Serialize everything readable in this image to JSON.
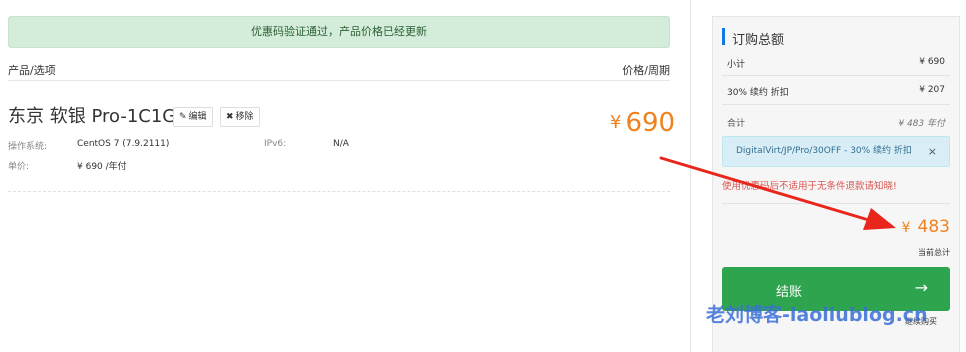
{
  "alert": {
    "text": "优惠码验证通过，产品价格已经更新"
  },
  "table_header": {
    "left": "产品/选项",
    "right": "价格/周期"
  },
  "product": {
    "name": "东京 软银 Pro-1C1G",
    "edit_label": "编辑",
    "remove_label": "移除",
    "price_currency": "¥",
    "price_value": "690",
    "os_label": "操作系统:",
    "os_value": "CentOS 7 (7.9.2111)",
    "ipv6_label": "IPv6:",
    "ipv6_value": "N/A",
    "unit_label": "单价:",
    "unit_value": "¥ 690 /年付"
  },
  "summary": {
    "title": "订购总额",
    "subtotal_label": "小计",
    "subtotal_value": "¥ 690",
    "discount_label": "30% 续约 折扣",
    "discount_value": "¥ 207",
    "total_label": "合计",
    "total_value": "¥ 483 年付",
    "promo_text": "DigitalVirt/JP/Pro/30OFF - 30% 续约 折扣",
    "promo_close": "×",
    "warning": "使用优惠码后不适用于无条件退款请知晓!",
    "grand_currency": "¥",
    "grand_value": "483",
    "grand_label": "当前总计",
    "checkout_label": "结账",
    "checkout_arrow": "→",
    "continue_label": "继续购买"
  },
  "watermark": "老刘博客-laoliublog.cn",
  "colors": {
    "accent_orange": "#f0821e",
    "checkout_green": "#2ea44f",
    "alert_green_bg": "#d4edda",
    "promo_blue_bg": "#d9edf7",
    "warning_red": "#d9534f",
    "annotation_red": "#e8261c"
  },
  "icons": {
    "edit": "pencil-icon",
    "remove": "x-icon",
    "checkout": "arrow-right-icon"
  }
}
